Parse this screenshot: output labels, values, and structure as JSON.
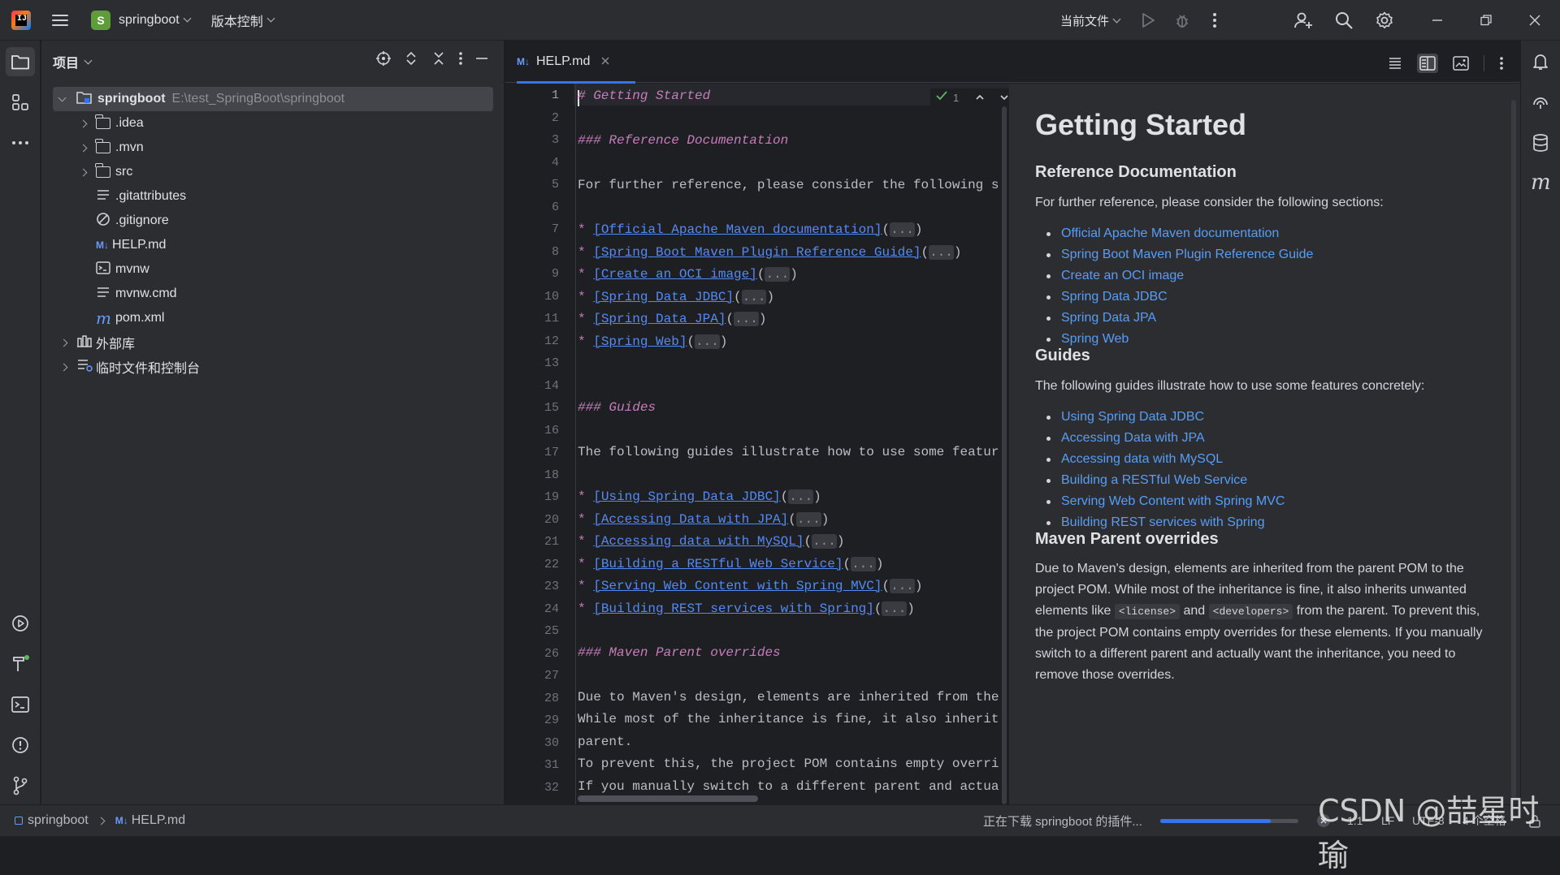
{
  "titlebar": {
    "project_badge": "S",
    "project_name": "springboot",
    "vcs_menu": "版本控制",
    "run_config": "当前文件"
  },
  "project_panel": {
    "title": "项目",
    "root_name": "springboot",
    "root_path": "E:\\test_SpringBoot\\springboot",
    "items": [
      {
        "label": ".idea",
        "type": "folder",
        "icon": "folder-icon"
      },
      {
        "label": ".mvn",
        "type": "folder",
        "icon": "folder-icon"
      },
      {
        "label": "src",
        "type": "folder",
        "icon": "folder-icon"
      },
      {
        "label": ".gitattributes",
        "type": "file",
        "icon": "text-file-icon"
      },
      {
        "label": ".gitignore",
        "type": "file",
        "icon": "ignore-file-icon"
      },
      {
        "label": "HELP.md",
        "type": "file",
        "icon": "markdown-file-icon"
      },
      {
        "label": "mvnw",
        "type": "file",
        "icon": "shell-file-icon"
      },
      {
        "label": "mvnw.cmd",
        "type": "file",
        "icon": "text-file-icon"
      },
      {
        "label": "pom.xml",
        "type": "file",
        "icon": "maven-file-icon"
      },
      {
        "label": "外部库",
        "type": "group",
        "icon": "library-icon"
      },
      {
        "label": "临时文件和控制台",
        "type": "group",
        "icon": "scratches-icon"
      }
    ]
  },
  "editor": {
    "tab_badge": "M↓",
    "tab_label": "HELP.md",
    "inspection_count": "1",
    "line_numbers": [
      "1",
      "2",
      "3",
      "4",
      "5",
      "6",
      "7",
      "8",
      "9",
      "10",
      "11",
      "12",
      "13",
      "14",
      "15",
      "16",
      "17",
      "18",
      "19",
      "20",
      "21",
      "22",
      "23",
      "24",
      "25",
      "26",
      "27",
      "28",
      "29",
      "30",
      "31",
      "32"
    ],
    "source": {
      "l1": "# Getting Started",
      "l3": "### Reference Documentation",
      "l5": "For further reference, please consider the following s",
      "l14": "### Guides",
      "l16": "The following guides illustrate how to use some featur",
      "l25": "### Maven Parent overrides",
      "l27": "Due to Maven's design, elements are inherited from the",
      "l28": "While most of the inheritance is fine, it also inherit",
      "l29": "parent.",
      "l30": "To prevent this, the project POM contains empty overri",
      "l31": "If you manually switch to a different parent and actua",
      "bullet": "*",
      "fold": "...",
      "ref_links": [
        "[Official Apache Maven documentation]",
        "[Spring Boot Maven Plugin Reference Guide]",
        "[Create an OCI image]",
        "[Spring Data JDBC]",
        "[Spring Data JPA]",
        "[Spring Web]"
      ],
      "guide_links": [
        "[Using Spring Data JDBC]",
        "[Accessing Data with JPA]",
        "[Accessing data with MySQL]",
        "[Building a RESTful Web Service]",
        "[Serving Web Content with Spring MVC]",
        "[Building REST services with Spring]"
      ]
    }
  },
  "preview": {
    "h1": "Getting Started",
    "h_ref": "Reference Documentation",
    "p_ref": "For further reference, please consider the following sections:",
    "ref_links": [
      "Official Apache Maven documentation",
      "Spring Boot Maven Plugin Reference Guide",
      "Create an OCI image",
      "Spring Data JDBC",
      "Spring Data JPA",
      "Spring Web"
    ],
    "h_guides": "Guides",
    "p_guides": "The following guides illustrate how to use some features concretely:",
    "guide_links": [
      "Using Spring Data JDBC",
      "Accessing Data with JPA",
      "Accessing data with MySQL",
      "Building a RESTful Web Service",
      "Serving Web Content with Spring MVC",
      "Building REST services with Spring"
    ],
    "h_maven": "Maven Parent overrides",
    "p_maven_1": "Due to Maven's design, elements are inherited from the parent POM to the project POM. While most of the inheritance is fine, it also inherits unwanted elements like",
    "code_license": "<license>",
    "p_and": "and",
    "code_developers": "<developers>",
    "p_maven_2": "from the parent. To prevent this, the project POM contains empty overrides for these elements. If you manually switch to a different parent and actually want the inheritance, you need to remove those overrides."
  },
  "statusbar": {
    "breadcrumb_project": "springboot",
    "breadcrumb_badge": "M↓",
    "breadcrumb_file": "HELP.md",
    "task_text": "正在下载 springboot 的插件...",
    "progress": 0.8,
    "position": "1:1",
    "line_sep": "LF",
    "encoding": "UTF-8",
    "indent": "4 个空格"
  },
  "watermark": "CSDN @喆星时瑜",
  "colors": {
    "accent": "#3574f0",
    "link": "#548af7",
    "heading_md": "#c77dbb",
    "background": "#1e1f22",
    "panel": "#2b2d30"
  }
}
